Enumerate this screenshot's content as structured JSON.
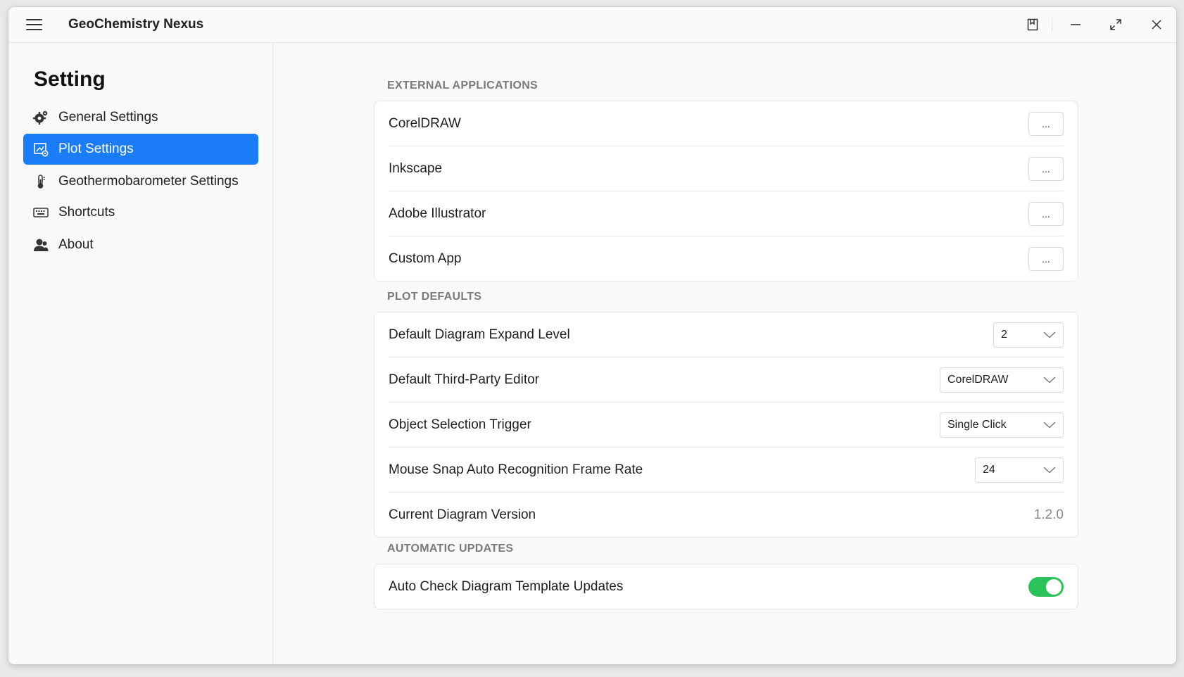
{
  "app": {
    "title": "GeoChemistry Nexus"
  },
  "sidebar": {
    "title": "Setting",
    "items": [
      {
        "label": "General Settings",
        "icon": "gear-icon",
        "active": false
      },
      {
        "label": "Plot Settings",
        "icon": "plot-settings-icon",
        "active": true
      },
      {
        "label": "Geothermobarometer Settings",
        "icon": "thermometer-icon",
        "active": false
      },
      {
        "label": "Shortcuts",
        "icon": "keyboard-icon",
        "active": false
      },
      {
        "label": "About",
        "icon": "person-icon",
        "active": false
      }
    ]
  },
  "sections": {
    "external": {
      "label": "EXTERNAL APPLICATIONS",
      "rows": [
        {
          "label": "CorelDRAW",
          "button": "..."
        },
        {
          "label": "Inkscape",
          "button": "..."
        },
        {
          "label": "Adobe Illustrator",
          "button": "..."
        },
        {
          "label": "Custom App",
          "button": "..."
        }
      ]
    },
    "plot_defaults": {
      "label": "PLOT DEFAULTS",
      "expand_level": {
        "label": "Default Diagram Expand Level",
        "value": "2"
      },
      "editor": {
        "label": "Default Third-Party Editor",
        "value": "CorelDRAW"
      },
      "selection": {
        "label": "Object Selection Trigger",
        "value": "Single Click"
      },
      "frame_rate": {
        "label": "Mouse Snap Auto Recognition Frame Rate",
        "value": "24"
      },
      "version": {
        "label": "Current Diagram Version",
        "value": "1.2.0"
      }
    },
    "updates": {
      "label": "AUTOMATIC UPDATES",
      "auto_check": {
        "label": "Auto Check Diagram Template Updates",
        "enabled": true
      }
    }
  },
  "colors": {
    "accent": "#1a7cf7",
    "toggle_on": "#29c35a"
  }
}
